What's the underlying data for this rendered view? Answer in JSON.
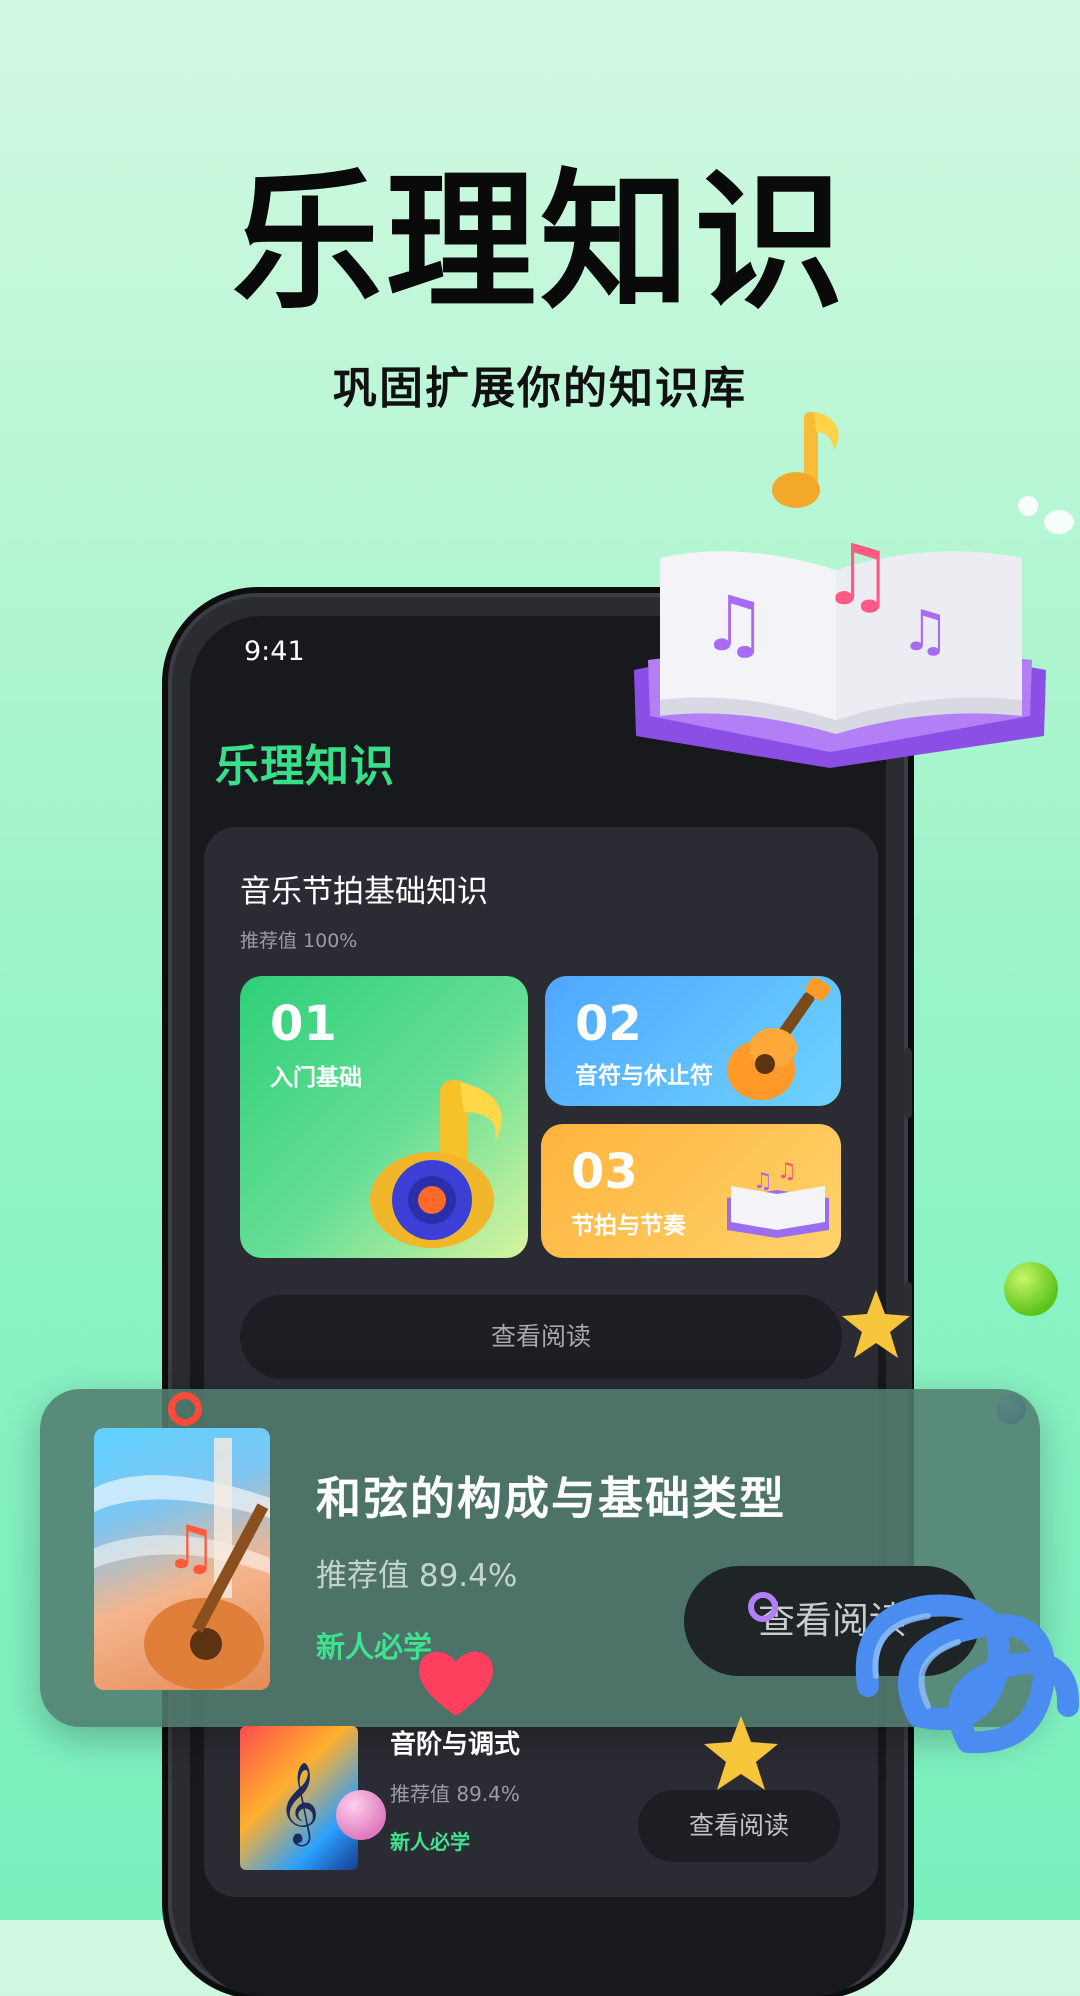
{
  "hero": {
    "title": "乐理知识",
    "subtitle": "巩固扩展你的知识库"
  },
  "status_bar": {
    "time": "9:41"
  },
  "app": {
    "title": "乐理知识"
  },
  "section": {
    "title": "音乐节拍基础知识",
    "recommend": "推荐值 100%",
    "tiles": [
      {
        "num": "01",
        "label": "入门基础"
      },
      {
        "num": "02",
        "label": "音符与休止符"
      },
      {
        "num": "03",
        "label": "节拍与节奏"
      }
    ],
    "read_button": "查看阅读"
  },
  "featured": {
    "title": "和弦的构成与基础类型",
    "recommend": "推荐值 89.4%",
    "tag": "新人必学",
    "button": "查看阅读"
  },
  "list_item": {
    "title": "音阶与调式",
    "recommend": "推荐值 89.4%",
    "tag": "新人必学",
    "button": "查看阅读"
  },
  "colors": {
    "accent_green": "#38e08a",
    "card_bg": "#2b2c33",
    "screen_bg": "#18191d"
  }
}
